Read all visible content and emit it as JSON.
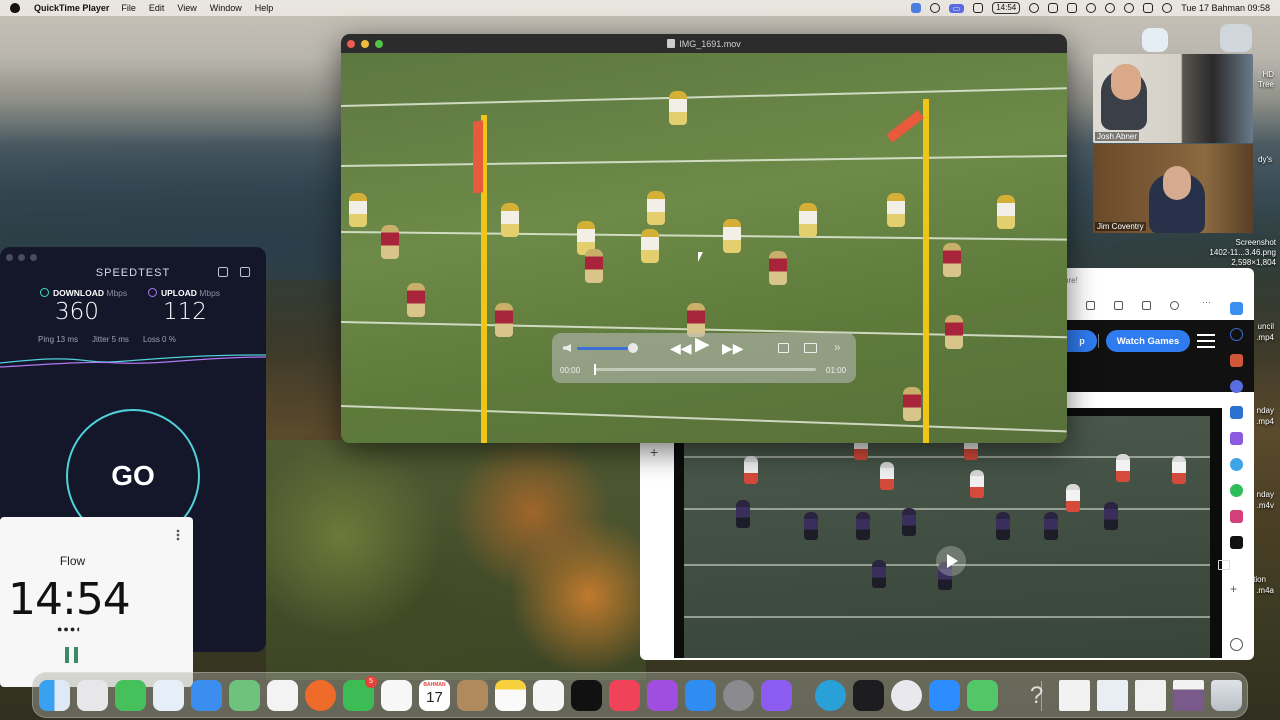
{
  "menubar": {
    "app_name": "QuickTime Player",
    "menus": [
      "File",
      "Edit",
      "View",
      "Window",
      "Help"
    ],
    "clock_badge": "14:54",
    "datetime": "Tue 17 Bahman  09:58"
  },
  "speedtest": {
    "brand": "SPEEDTEST",
    "download_label": "DOWNLOAD",
    "upload_label": "UPLOAD",
    "unit": "Mbps",
    "download_value": "360",
    "upload_value": "112",
    "ping": "Ping 13 ms",
    "jitter": "Jitter 5 ms",
    "loss": "Loss 0 %",
    "go_label": "GO"
  },
  "flow": {
    "label": "Flow",
    "time": "14:54",
    "session_dots": "●●●◐"
  },
  "quicktime": {
    "filename": "IMG_1691.mov",
    "time_current": "00:00",
    "time_total": "01:00",
    "volume_fraction": 0.85,
    "progress_fraction": 0.0
  },
  "browser": {
    "store_note": "ore!",
    "partial_button": "p",
    "watch_games": "Watch Games"
  },
  "zoom": {
    "participant1": "Josh Abner",
    "participant2": "Jim Coventry"
  },
  "desktop": {
    "screenshot_label": "Screenshot",
    "screenshot_name": "1402-11...3.46.png",
    "screenshot_size": "2,598×1,804",
    "edge_fragments": [
      "HD",
      "Tree",
      "dy's",
      "uncil",
      ".mp4",
      "nday",
      ".mp4",
      "nday",
      ".m4v",
      "tion",
      ".m4a"
    ]
  },
  "dock": {
    "calendar_month": "BAHMAN",
    "calendar_day": "17",
    "facetime_badge": "5",
    "apps": [
      "finder",
      "launchpad",
      "messages",
      "safari",
      "mail",
      "maps",
      "photos",
      "firefox",
      "facetime",
      "reminders",
      "calendar",
      "contacts",
      "notes",
      "freeform",
      "apple-tv",
      "music",
      "podcasts",
      "app-store",
      "system-settings",
      "feedback",
      "edge",
      "activity-monitor",
      "quicktime",
      "zoom",
      "messages-2",
      "help",
      "doc-1",
      "doc-2",
      "doc-3",
      "doc-4",
      "trash"
    ]
  },
  "colors": {
    "accent_blue": "#2f7bf0",
    "speedtest_teal": "#4fd1d9",
    "packers_green": "#5e7a3b",
    "niners_red": "#a8243a"
  }
}
